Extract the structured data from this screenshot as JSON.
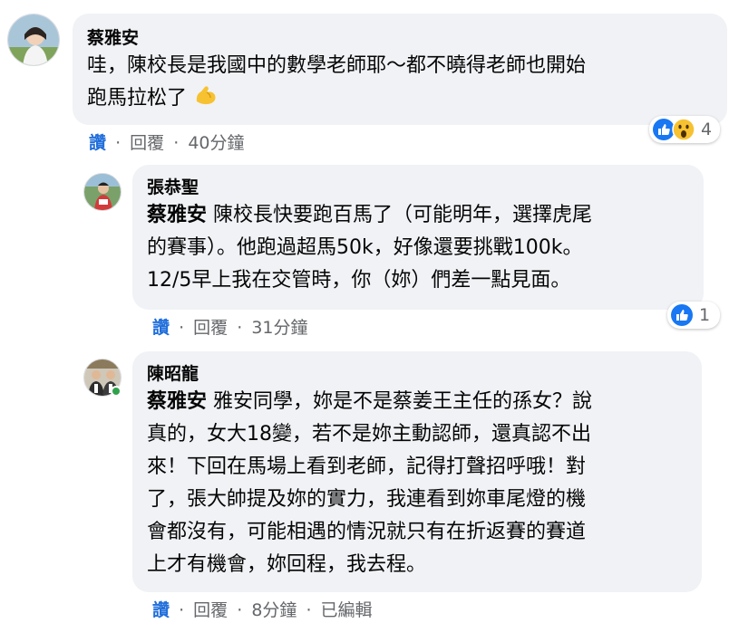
{
  "comments": [
    {
      "author": "蔡雅安",
      "mention": "",
      "text_line1": "哇，陳校長是我國中的數學老師耶～都不曉得老師也開始",
      "text_line2": "跑馬拉松了",
      "emoji": "flexed-biceps-emoji",
      "like_label": "讚",
      "reply_label": "回覆",
      "time": "40分鐘",
      "reaction_count": "4",
      "reactions": [
        "like",
        "wow"
      ]
    },
    {
      "author": "張恭聖",
      "mention": "蔡雅安",
      "text_line1": " 陳校長快要跑百馬了（可能明年，選擇虎尾",
      "text_line2": "的賽事）。他跑過超馬50k，好像還要挑戰100k。",
      "text_line3": "12/5早上我在交管時，你（妳）們差一點見面。",
      "like_label": "讚",
      "reply_label": "回覆",
      "time": "31分鐘",
      "reaction_count": "1",
      "reactions": [
        "like"
      ]
    },
    {
      "author": "陳昭龍",
      "mention": "蔡雅安",
      "text_line1": " 雅安同學，妳是不是蔡姜王主任的孫女？說",
      "text_line2": "真的，女大18變，若不是妳主動認師，還真認不出",
      "text_line3": "來！下回在馬場上看到老師，記得打聲招呼哦！對",
      "text_line4": "了，張大帥提及妳的實力，我連看到妳車尾燈的機",
      "text_line5": "會都沒有，可能相遇的情況就只有在折返賽的賽道",
      "text_line6": "上才有機會，妳回程，我去程。",
      "like_label": "讚",
      "reply_label": "回覆",
      "time": "8分鐘",
      "edited_label": "已編輯"
    }
  ],
  "separator": "·",
  "colors": {
    "bubble": "#f0f2f5",
    "like_blue": "#216fdb",
    "meta_gray": "#65676b",
    "online_green": "#31a24c"
  }
}
